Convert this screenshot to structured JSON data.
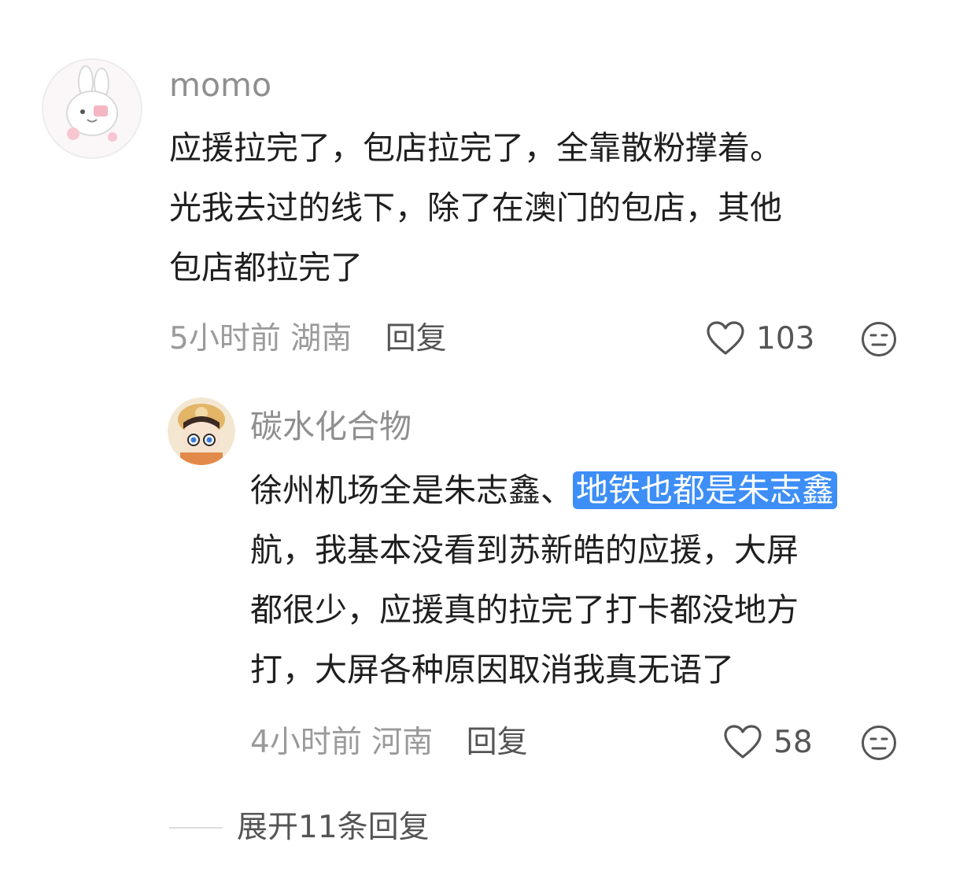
{
  "comment": {
    "username": "momo",
    "lines": [
      "应援拉完了，包店拉完了，全靠散粉撑着。",
      "光我去过的线下，除了在澳门的包店，其他",
      "包店都拉完了"
    ],
    "time": "5小时前",
    "location": "湖南",
    "reply_label": "回复",
    "likes": "103",
    "like_icon": "heart-outline-icon",
    "dislike_icon": "meh-face-icon"
  },
  "reply": {
    "username": "碳水化合物",
    "line1_before": "徐州机场全是朱志鑫、",
    "line1_highlight": "地铁也都是朱志鑫",
    "lines_rest": [
      "航，我基本没看到苏新皓的应援，大屏",
      "都很少，应援真的拉完了打卡都没地方",
      "打，大屏各种原因取消我真无语了"
    ],
    "time": "4小时前",
    "location": "河南",
    "reply_label": "回复",
    "likes": "58",
    "highlight_color": "#3d8ef6"
  },
  "expand_label": "展开11条回复"
}
